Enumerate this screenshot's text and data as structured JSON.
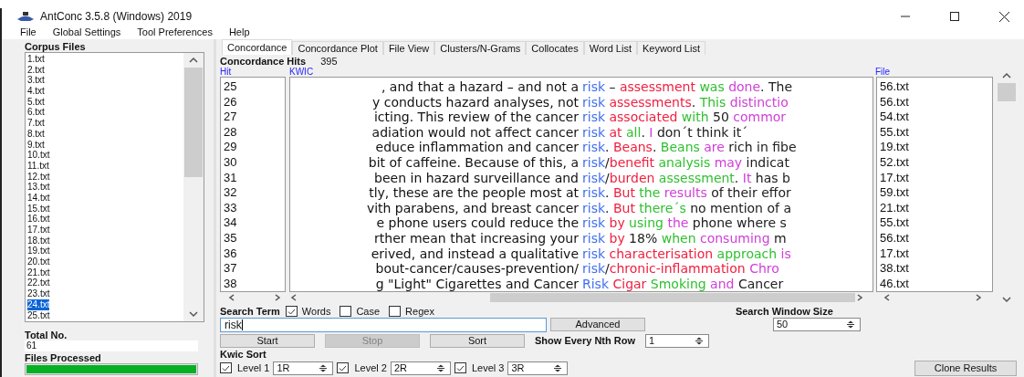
{
  "window": {
    "title": "AntConc 3.5.8 (Windows) 2019"
  },
  "menu": [
    "File",
    "Global Settings",
    "Tool Preferences",
    "Help"
  ],
  "corpus": {
    "label": "Corpus Files",
    "files": [
      {
        "name": "1.txt",
        "selected": false
      },
      {
        "name": "2.txt",
        "selected": false
      },
      {
        "name": "3.txt",
        "selected": false
      },
      {
        "name": "4.txt",
        "selected": false
      },
      {
        "name": "5.txt",
        "selected": false
      },
      {
        "name": "6.txt",
        "selected": false
      },
      {
        "name": "7.txt",
        "selected": false
      },
      {
        "name": "8.txt",
        "selected": false
      },
      {
        "name": "9.txt",
        "selected": false
      },
      {
        "name": "10.txt",
        "selected": false
      },
      {
        "name": "11.txt",
        "selected": false
      },
      {
        "name": "12.txt",
        "selected": false
      },
      {
        "name": "13.txt",
        "selected": false
      },
      {
        "name": "14.txt",
        "selected": false
      },
      {
        "name": "15.txt",
        "selected": false
      },
      {
        "name": "16.txt",
        "selected": false
      },
      {
        "name": "17.txt",
        "selected": false
      },
      {
        "name": "18.txt",
        "selected": false
      },
      {
        "name": "19.txt",
        "selected": false
      },
      {
        "name": "20.txt",
        "selected": false
      },
      {
        "name": "21.txt",
        "selected": false
      },
      {
        "name": "22.txt",
        "selected": false
      },
      {
        "name": "23.txt",
        "selected": false
      },
      {
        "name": "24.txt",
        "selected": true
      },
      {
        "name": "25.txt",
        "selected": false
      }
    ],
    "total_label": "Total No.",
    "total": "61",
    "processed_label": "Files Processed",
    "progress": {
      "level": 1
    }
  },
  "tabs": [
    {
      "label": "Concordance",
      "selected": true
    },
    {
      "label": "Concordance Plot",
      "selected": false
    },
    {
      "label": "File View",
      "selected": false
    },
    {
      "label": "Clusters/N-Grams",
      "selected": false
    },
    {
      "label": "Collocates",
      "selected": false
    },
    {
      "label": "Word List",
      "selected": false
    },
    {
      "label": "Keyword List",
      "selected": false
    }
  ],
  "hits": {
    "label": "Concordance Hits",
    "count": "395"
  },
  "columns": {
    "hit": "Hit",
    "kwic": "KWIC",
    "file": "File"
  },
  "rows": [
    {
      "hit": "25",
      "left": ", and that a hazard – and not a",
      "right": [
        {
          "text": "risk",
          "color": "#3f6ff0"
        },
        {
          "text": " – "
        },
        {
          "text": "assessment",
          "color": "#f02040"
        },
        {
          "text": " was",
          "color": "#30c030"
        },
        {
          "text": " done",
          "color": "#d040d8"
        },
        {
          "text": ". The",
          "color": "#202020"
        }
      ],
      "file": "56.txt"
    },
    {
      "hit": "26",
      "left": "y conducts hazard analyses, not",
      "right": [
        {
          "text": "risk",
          "color": "#3f6ff0"
        },
        {
          "text": " assessments",
          "color": "#f02040"
        },
        {
          "text": ". "
        },
        {
          "text": "This",
          "color": "#30c030"
        },
        {
          "text": " distinctio",
          "color": "#d040d8"
        }
      ],
      "file": "56.txt"
    },
    {
      "hit": "27",
      "left": "icting. This review of the cancer",
      "right": [
        {
          "text": "risk",
          "color": "#3f6ff0"
        },
        {
          "text": " associated",
          "color": "#f02040"
        },
        {
          "text": " with",
          "color": "#30c030"
        },
        {
          "text": " 50",
          "color": "#202020"
        },
        {
          "text": " commor",
          "color": "#d040d8"
        }
      ],
      "file": "54.txt"
    },
    {
      "hit": "28",
      "left": "adiation would not affect cancer",
      "right": [
        {
          "text": "risk",
          "color": "#3f6ff0"
        },
        {
          "text": " at",
          "color": "#f02040"
        },
        {
          "text": " all",
          "color": "#30c030"
        },
        {
          "text": ". "
        },
        {
          "text": "I",
          "color": "#d040d8"
        },
        {
          "text": " don´t think it´",
          "color": "#202020"
        }
      ],
      "file": "55.txt"
    },
    {
      "hit": "29",
      "left": "educe inflammation and cancer",
      "right": [
        {
          "text": "risk",
          "color": "#3f6ff0"
        },
        {
          "text": ". "
        },
        {
          "text": "Beans",
          "color": "#f02040"
        },
        {
          "text": ". "
        },
        {
          "text": "Beans",
          "color": "#30c030"
        },
        {
          "text": " are",
          "color": "#d040d8"
        },
        {
          "text": " rich in fibe",
          "color": "#202020"
        }
      ],
      "file": "19.txt"
    },
    {
      "hit": "30",
      "left": "bit of caffeine. Because of this, a",
      "right": [
        {
          "text": "risk",
          "color": "#3f6ff0"
        },
        {
          "text": "/"
        },
        {
          "text": "benefit",
          "color": "#f02040"
        },
        {
          "text": " analysis",
          "color": "#30c030"
        },
        {
          "text": " may",
          "color": "#d040d8"
        },
        {
          "text": " indicat",
          "color": "#202020"
        }
      ],
      "file": "52.txt"
    },
    {
      "hit": "31",
      "left": "been in hazard surveillance and",
      "right": [
        {
          "text": "risk",
          "color": "#3f6ff0"
        },
        {
          "text": "/"
        },
        {
          "text": "burden",
          "color": "#f02040"
        },
        {
          "text": " assessment",
          "color": "#30c030"
        },
        {
          "text": ". "
        },
        {
          "text": "It",
          "color": "#d040d8"
        },
        {
          "text": " has b",
          "color": "#202020"
        }
      ],
      "file": "17.txt"
    },
    {
      "hit": "32",
      "left": "tly, these are the people most at",
      "right": [
        {
          "text": "risk",
          "color": "#3f6ff0"
        },
        {
          "text": ". "
        },
        {
          "text": "But",
          "color": "#f02040"
        },
        {
          "text": " the",
          "color": "#30c030"
        },
        {
          "text": " results",
          "color": "#d040d8"
        },
        {
          "text": " of their effor",
          "color": "#202020"
        }
      ],
      "file": "59.txt"
    },
    {
      "hit": "33",
      "left": "vith parabens, and breast cancer",
      "right": [
        {
          "text": "risk",
          "color": "#3f6ff0"
        },
        {
          "text": ". "
        },
        {
          "text": "But",
          "color": "#f02040"
        },
        {
          "text": " there´s",
          "color": "#30c030"
        },
        {
          "text": " no mention of a",
          "color": "#202020"
        }
      ],
      "file": "21.txt"
    },
    {
      "hit": "34",
      "left": "e phone users could reduce the",
      "right": [
        {
          "text": "risk",
          "color": "#3f6ff0"
        },
        {
          "text": " by",
          "color": "#f02040"
        },
        {
          "text": " using",
          "color": "#30c030"
        },
        {
          "text": " the",
          "color": "#d040d8"
        },
        {
          "text": " phone where s",
          "color": "#202020"
        }
      ],
      "file": "55.txt"
    },
    {
      "hit": "35",
      "left": "rther mean that increasing your",
      "right": [
        {
          "text": "risk",
          "color": "#3f6ff0"
        },
        {
          "text": " by",
          "color": "#f02040"
        },
        {
          "text": " 18%",
          "color": "#202020"
        },
        {
          "text": " when",
          "color": "#30c030"
        },
        {
          "text": " consuming",
          "color": "#d040d8"
        },
        {
          "text": " m",
          "color": "#202020"
        }
      ],
      "file": "56.txt"
    },
    {
      "hit": "36",
      "left": "erived, and instead a qualitative",
      "right": [
        {
          "text": "risk",
          "color": "#3f6ff0"
        },
        {
          "text": " characterisation",
          "color": "#f02040"
        },
        {
          "text": " approach",
          "color": "#30c030"
        },
        {
          "text": " is",
          "color": "#d040d8"
        }
      ],
      "file": "17.txt"
    },
    {
      "hit": "37",
      "left": "bout-cancer/causes-prevention/",
      "right": [
        {
          "text": "risk",
          "color": "#3f6ff0"
        },
        {
          "text": "/"
        },
        {
          "text": "chronic-inflammation",
          "color": "#f02040"
        },
        {
          "text": " Chro",
          "color": "#d040d8"
        }
      ],
      "file": "38.txt"
    },
    {
      "hit": "38",
      "left": "g \"Light\" Cigarettes and Cancer",
      "right": [
        {
          "text": "Risk",
          "color": "#3f6ff0"
        },
        {
          "text": " Cigar",
          "color": "#f02040"
        },
        {
          "text": " Smoking",
          "color": "#30c030"
        },
        {
          "text": " and",
          "color": "#d040d8"
        },
        {
          "text": " Cancer",
          "color": "#202020"
        }
      ],
      "file": "46.txt"
    }
  ],
  "search": {
    "label": "Search Term",
    "options": [
      {
        "label": "Words",
        "checked": true
      },
      {
        "label": "Case",
        "checked": false
      },
      {
        "label": "Regex",
        "checked": false
      }
    ],
    "value": "risk",
    "advanced": "Advanced",
    "window_label": "Search Window Size",
    "window_size": "50"
  },
  "actions": [
    {
      "label": "Start",
      "disabled": false
    },
    {
      "label": "Stop",
      "disabled": true
    },
    {
      "label": "Sort",
      "disabled": false
    }
  ],
  "nth_row": {
    "label": "Show Every Nth Row",
    "value": "1"
  },
  "kwic_sort": {
    "label": "Kwic Sort",
    "levels": [
      {
        "label": "Level 1",
        "checked": true,
        "value": "1R"
      },
      {
        "label": "Level 2",
        "checked": true,
        "value": "2R"
      },
      {
        "label": "Level 3",
        "checked": true,
        "value": "3R"
      }
    ]
  },
  "clone": "Clone Results"
}
